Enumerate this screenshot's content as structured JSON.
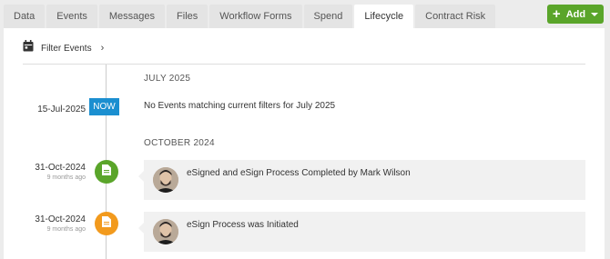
{
  "tabs": [
    {
      "label": "Data",
      "active": false
    },
    {
      "label": "Events",
      "active": false
    },
    {
      "label": "Messages",
      "active": false
    },
    {
      "label": "Files",
      "active": false
    },
    {
      "label": "Workflow Forms",
      "active": false
    },
    {
      "label": "Spend",
      "active": false
    },
    {
      "label": "Lifecycle",
      "active": true
    },
    {
      "label": "Contract Risk",
      "active": false
    }
  ],
  "add_button": {
    "label": "Add",
    "color": "#5aa52a"
  },
  "filter": {
    "label": "Filter Events",
    "icon": "calendar-icon"
  },
  "timeline": {
    "groups": [
      {
        "month": "JULY 2025",
        "date": "15-Jul-2025",
        "badge": "NOW",
        "badge_color": "#1b8fd0",
        "message": "No Events matching current filters for July 2025"
      },
      {
        "month": "OCTOBER 2024",
        "events": [
          {
            "date": "31-Oct-2024",
            "ago": "9 months ago",
            "icon": "document-icon",
            "marker_color": "#5aa52a",
            "text": "eSigned and eSign Process Completed by Mark Wilson"
          },
          {
            "date": "31-Oct-2024",
            "ago": "9 months ago",
            "icon": "document-icon",
            "marker_color": "#f29a1d",
            "text": "eSign Process was Initiated"
          }
        ]
      }
    ]
  }
}
